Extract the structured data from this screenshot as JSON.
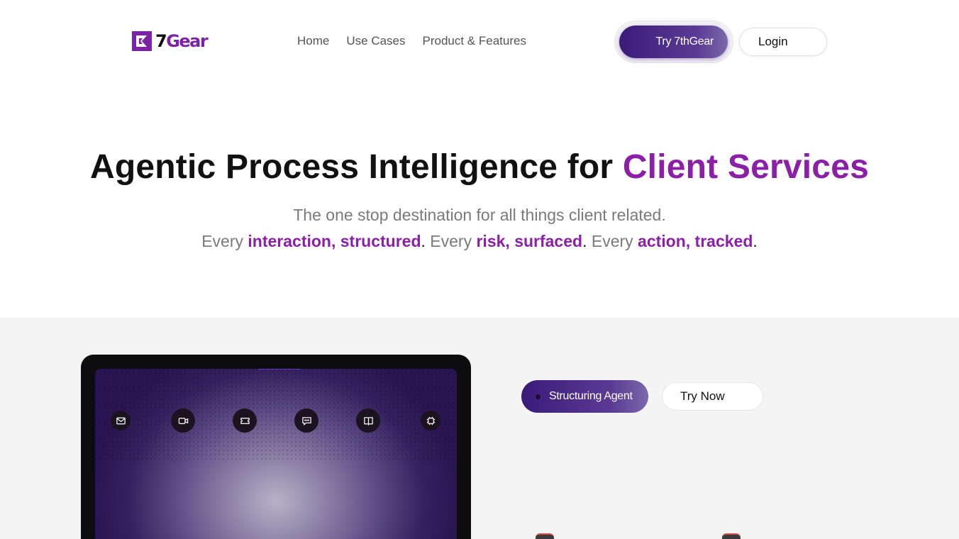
{
  "nav": {
    "logo_text_a": "7",
    "logo_text_b": "Gear",
    "links": [
      "Home",
      "Use Cases",
      "Product & Features"
    ],
    "try_label": "Try 7thGear",
    "login_label": "Login"
  },
  "hero": {
    "title_main": "Agentic Process Intelligence for ",
    "title_accent": "Client Services",
    "subtitle": "The one stop destination for all things client related.",
    "line2": {
      "every1": "Every ",
      "hl1": "interaction, structured",
      "every2": "Every ",
      "hl2": "risk, surfaced",
      "every3": "Every ",
      "hl3": "action, tracked",
      "period": "."
    }
  },
  "demo": {
    "icons": [
      "mail-icon",
      "video-icon",
      "ticket-icon",
      "chat-icon",
      "book-icon",
      "chip-icon"
    ],
    "agent_label": "Structuring Agent",
    "try_now_label": "Try Now"
  },
  "colors": {
    "accent": "#8b1fa8",
    "button_gradient_start": "#3a1b7a",
    "button_gradient_end": "#7b68ab",
    "section_bg": "#f4f4f4"
  }
}
